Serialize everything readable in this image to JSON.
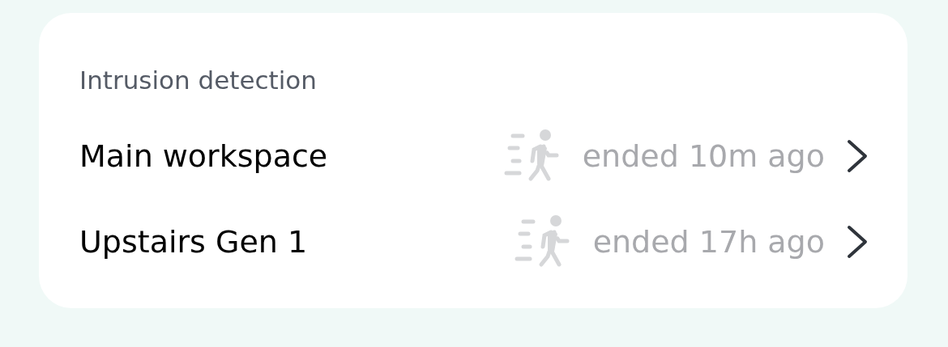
{
  "section": {
    "title": "Intrusion detection"
  },
  "rows": [
    {
      "name": "Main workspace",
      "status": "ended 10m ago"
    },
    {
      "name": "Upstairs Gen 1",
      "status": "ended 17h ago"
    }
  ]
}
